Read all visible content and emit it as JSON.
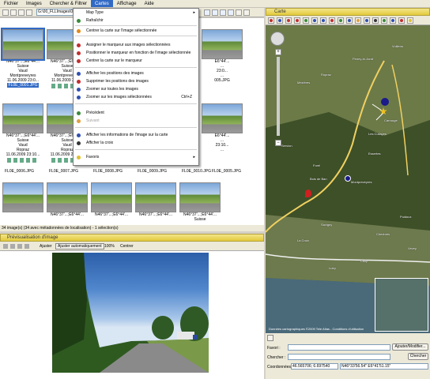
{
  "menubar": {
    "items": [
      "Fichier",
      "Images",
      "Chercher & Filtrer",
      "Cartes",
      "Affichage",
      "Aide"
    ],
    "active_index": 3
  },
  "toolbar": {
    "path": "G:\\00_FLLImages\\00"
  },
  "thumbnails": [
    {
      "coords": "N46°37'...;E6°44'...",
      "country": "Suisse",
      "canton": "Vaud",
      "place": "Montpreveyres",
      "date": "11.06.2009 23:0...",
      "file": "FL0E_0001.JPG",
      "selected": true
    },
    {
      "coords": "N46°37'...;E6°44'...",
      "country": "Suisse",
      "canton": "Vaud",
      "place": "Montpreveyres",
      "date": "11.06.2009 23:0...",
      "file": "",
      "selected": false
    },
    {
      "coords": "N46°37'...;E6°44'...",
      "country": "Suisse",
      "canton": "Vaud",
      "place": "Ropraz",
      "date": "11.06.2009 23:10...",
      "file": "",
      "selected": false
    },
    {
      "coords": "N46°37'...;E6°44'...",
      "country": "Suisse",
      "canton": "Vaud",
      "place": "Ropraz",
      "date": "11.06.2009 23:10...",
      "file": "",
      "selected": false
    },
    {
      "coords": "",
      "country": "",
      "canton": "",
      "place": "",
      "date": "",
      "file": "FL0E_0006.JPG",
      "selected": false
    },
    {
      "coords": "",
      "country": "",
      "canton": "",
      "place": "",
      "date": "",
      "file": "FL0E_0007.JPG",
      "selected": false
    },
    {
      "coords": "N46°37'...;E6°44'...",
      "country": "",
      "canton": "",
      "place": "",
      "date": "",
      "file": "",
      "selected": false
    },
    {
      "coords": "N46°37'...;E6°44'...",
      "country": "",
      "canton": "",
      "place": "",
      "date": "",
      "file": "",
      "selected": false
    },
    {
      "coords": "N46°37'...;E6°44'...",
      "country": "",
      "canton": "",
      "place": "",
      "date": "",
      "file": "",
      "selected": false
    },
    {
      "coords": "N46°37'...;E6°44'...",
      "country": "Suisse",
      "canton": "",
      "place": "",
      "date": "",
      "file": "",
      "selected": false
    }
  ],
  "right_thumb_labels": [
    "E6°44'...",
    "...",
    "23:0...",
    "...",
    "005.JPG",
    "E6°44'...",
    "...",
    "23:10...",
    "...",
    "FL0E_0005.JPG",
    "FL0E_0008.JPG",
    "FL0E_0009.JPG",
    "FL0E_0010.JPG"
  ],
  "menu": {
    "items": [
      {
        "label": "Map Type",
        "arrow": "▸",
        "icon": "",
        "disabled": false
      },
      {
        "label": "Rafraîchir",
        "icon": "#3a8a3a",
        "disabled": false
      },
      {
        "label": "Centrer la carte sur l'image sélectionnée",
        "icon": "#e08a1a",
        "disabled": false
      },
      {
        "label": "Assigner le marqueur aux images sélectionnées",
        "icon": "#c03030",
        "disabled": false
      },
      {
        "label": "Positionner le marqueur en fonction de l'image sélectionnée",
        "icon": "#c03030",
        "disabled": false
      },
      {
        "label": "Centrer la carte sur le marqueur",
        "icon": "#c03030",
        "disabled": false
      },
      {
        "label": "Afficher les positions des images",
        "icon": "#3050b0",
        "disabled": false
      },
      {
        "label": "Supprimer les positions des images",
        "icon": "#c03030",
        "disabled": false
      },
      {
        "label": "Zoomer sur toutes les images",
        "icon": "#3050b0",
        "disabled": false
      },
      {
        "label": "Zoomer sur les images sélectionnées",
        "icon": "#3050b0",
        "shortcut": "Ctrl+Z",
        "disabled": false
      },
      {
        "label": "Précédent",
        "icon": "#3a8a3a",
        "disabled": false
      },
      {
        "label": "Suivant",
        "icon": "#e0a040",
        "disabled": true
      },
      {
        "label": "Afficher les informations de l'image sur la carte",
        "icon": "#3050b0",
        "disabled": false
      },
      {
        "label": "Afficher la croix",
        "icon": "#333333",
        "disabled": false
      },
      {
        "label": "Favoris",
        "arrow": "▸",
        "icon": "#e0c030",
        "disabled": false
      }
    ]
  },
  "status": {
    "text": "34 image(s) (34 avec métadonnées de localisation) - 1 sélection(s)"
  },
  "preview": {
    "title": "Prévisualisation d'image",
    "ajuster": "Ajuster",
    "ajuster_auto": "Ajuster automatiquement",
    "zoom": "100%",
    "centrer": "Centrer"
  },
  "map": {
    "title": "Carte",
    "places": [
      "Ropraz",
      "Peney-le-Jorat",
      "Vulliens",
      "Mézières",
      "Carrouge",
      "Servion",
      "Essertes",
      "Forel",
      "Savigny",
      "La Croix",
      "Chexbres",
      "Cully",
      "Lutry",
      "Bois de Ban",
      "Montpreveyres",
      "Les Cullayes",
      "Puidoux",
      "Vevey"
    ],
    "copyright": "Données cartographiques ©2009 Tele Atlas - Conditions d'utilisation"
  },
  "bottom": {
    "favoris_label": "Favori :",
    "favoris_btn": "Ajouter/Modifier...",
    "chercher_label": "Chercher :",
    "chercher_btn": "Chercher",
    "coords_label": "Coordonnées :",
    "coords_decimal": "46.565706; 6.697540",
    "coords_dms": "N46°33'56.54\" E6°41'51.15\""
  }
}
